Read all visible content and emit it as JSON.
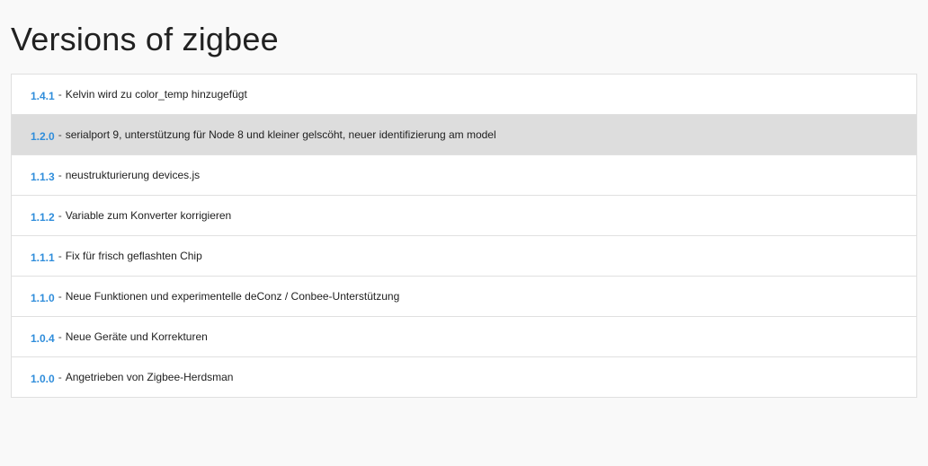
{
  "page": {
    "title": "Versions of zigbee"
  },
  "versions": [
    {
      "number": "1.4.1",
      "description": "Kelvin wird zu color_temp hinzugefügt",
      "active": false
    },
    {
      "number": "1.2.0",
      "description": "serialport 9, unterstützung für Node 8 und kleiner gelscöht, neuer identifizierung am model",
      "active": true
    },
    {
      "number": "1.1.3",
      "description": "neustrukturierung devices.js",
      "active": false
    },
    {
      "number": "1.1.2",
      "description": "Variable zum Konverter korrigieren",
      "active": false
    },
    {
      "number": "1.1.1",
      "description": "Fix für frisch geflashten Chip",
      "active": false
    },
    {
      "number": "1.1.0",
      "description": "Neue Funktionen und experimentelle deConz / Conbee-Unterstützung",
      "active": false
    },
    {
      "number": "1.0.4",
      "description": "Neue Geräte und Korrekturen",
      "active": false
    },
    {
      "number": "1.0.0",
      "description": "Angetrieben von Zigbee-Herdsman",
      "active": false
    }
  ],
  "separator": "-",
  "colors": {
    "version_number": "#2f8ddb",
    "active_row": "#dddddd",
    "background": "#f9f9f9"
  }
}
